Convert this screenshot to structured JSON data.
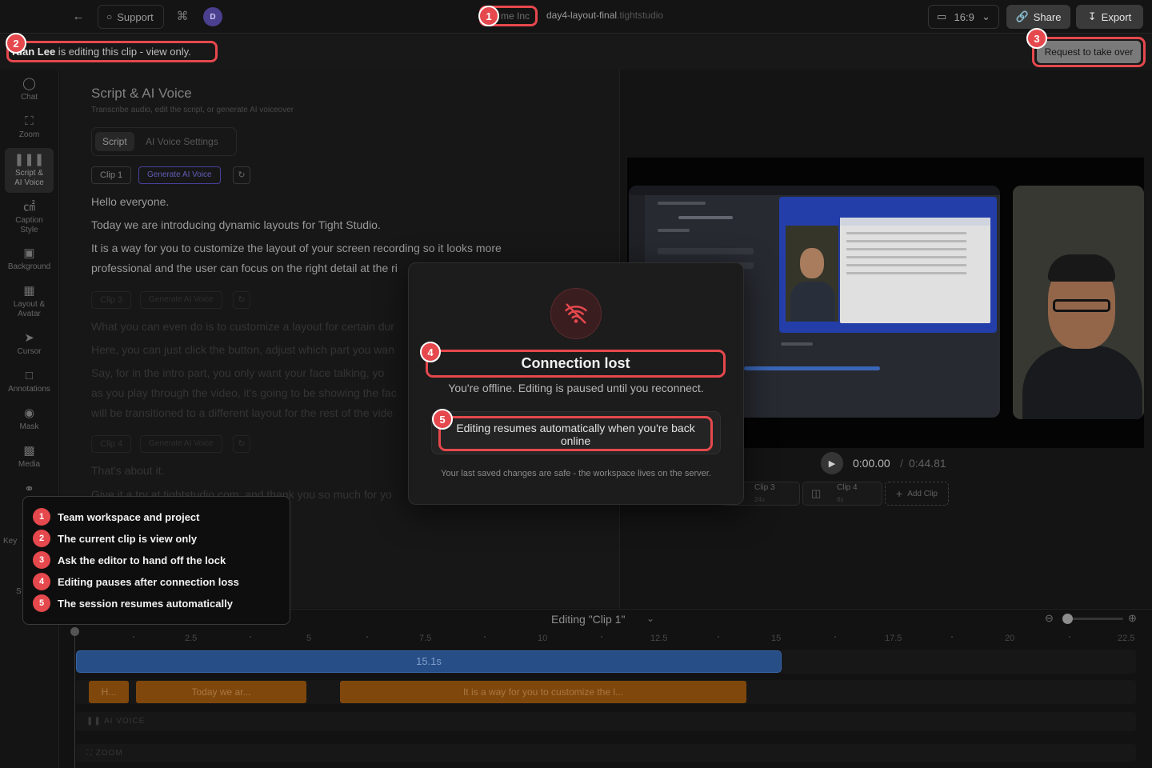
{
  "topbar": {
    "back_icon": "arrow-left-icon",
    "support_label": "Support",
    "cmd_icon": "command-icon",
    "avatar_initial": "D",
    "workspace": "me Inc",
    "project_name": "day4-layout-final",
    "project_domain": ".tightstudio",
    "aspect_ratio": "16:9",
    "share_label": "Share",
    "export_label": "Export"
  },
  "banner": {
    "editor_name": "rdan Lee",
    "message": " is editing this clip - view only.",
    "takeover_label": "Request to take over"
  },
  "sidebar": {
    "items": [
      {
        "label": "Chat",
        "icon": "chat-icon"
      },
      {
        "label": "Zoom",
        "icon": "zoom-icon"
      },
      {
        "label": "Script &\nAI Voice",
        "icon": "waveform-icon"
      },
      {
        "label": "Caption\nStyle",
        "icon": "caption-icon"
      },
      {
        "label": "Background",
        "icon": "image-icon"
      },
      {
        "label": "Layout &\nAvatar",
        "icon": "layout-icon"
      },
      {
        "label": "Cursor",
        "icon": "cursor-icon"
      },
      {
        "label": "Annotations",
        "icon": "annotation-icon"
      },
      {
        "label": "Mask",
        "icon": "eye-icon"
      },
      {
        "label": "Media",
        "icon": "media-icon"
      },
      {
        "label": "A",
        "icon": "headphones-icon"
      }
    ],
    "key_label": "Key",
    "s_label": "S"
  },
  "script_panel": {
    "title": "Script & AI Voice",
    "subtitle": "Transcribe audio, edit the script, or generate AI voiceover",
    "tabs": [
      "Script",
      "AI Voice Settings"
    ],
    "generate_label": "Generate AI Voice",
    "clips": [
      {
        "name": "Clip 1",
        "lines": [
          "Hello everyone.",
          "Today we are introducing dynamic layouts for Tight Studio.",
          "It is a way for you to customize the layout of your screen recording so it looks more",
          "professional and the user can focus on the right detail at the ri"
        ]
      },
      {
        "name": "Clip 3",
        "lines": [
          "What you can even do is to customize a layout for certain dur",
          "Here, you can just click the button, adjust which part you wan",
          "Say, for in the intro part, you only want your face talking, yo",
          "as you play through the video, it's going to be showing the fac",
          "will be transitioned to a different layout for the rest of the vide"
        ]
      },
      {
        "name": "Clip 4",
        "lines": [
          "That's about it.",
          "Give it a try at tightstudio.com, and thank you so much for yo"
        ]
      }
    ]
  },
  "preview": {
    "play_icon": "play-icon",
    "time_current": "0:00.00",
    "time_separator": "/",
    "time_total": "0:44.81",
    "clips": [
      {
        "name": "Clip 3",
        "duration": "24s"
      },
      {
        "name": "Clip 4",
        "duration": "6s"
      }
    ],
    "add_clip_label": "Add Clip"
  },
  "timeline": {
    "editing_label": "Editing \"Clip 1\"",
    "ticks": [
      "2.5",
      "5",
      "7.5",
      "10",
      "12.5",
      "15",
      "17.5",
      "20",
      "22.5"
    ],
    "clip_duration": "15.1s",
    "script_segments": [
      "H...",
      "Today we ar...",
      "It is a way for you to customize the l..."
    ],
    "track_ai_voice": "AI VOICE",
    "track_zoom": "ZOOM"
  },
  "modal": {
    "icon": "wifi-off-icon",
    "title": "Connection lost",
    "description": "You're offline. Editing is paused until you reconnect.",
    "resume_note": "Editing resumes automatically when you're back online",
    "footer": "Your last saved changes are safe - the workspace lives on the server."
  },
  "legend": {
    "items": [
      {
        "num": "1",
        "text": "Team workspace and project"
      },
      {
        "num": "2",
        "text": "The current clip is view only"
      },
      {
        "num": "3",
        "text": "Ask the editor to hand off the lock"
      },
      {
        "num": "4",
        "text": "Editing pauses after connection loss"
      },
      {
        "num": "5",
        "text": "The session resumes automatically"
      }
    ]
  },
  "markers": [
    "1",
    "2",
    "3",
    "4",
    "5"
  ],
  "colors": {
    "accent_red": "#e5484d",
    "clip_blue": "#2b5592",
    "script_orange": "#8a4e0e",
    "ai_purple": "#4f46a8"
  }
}
